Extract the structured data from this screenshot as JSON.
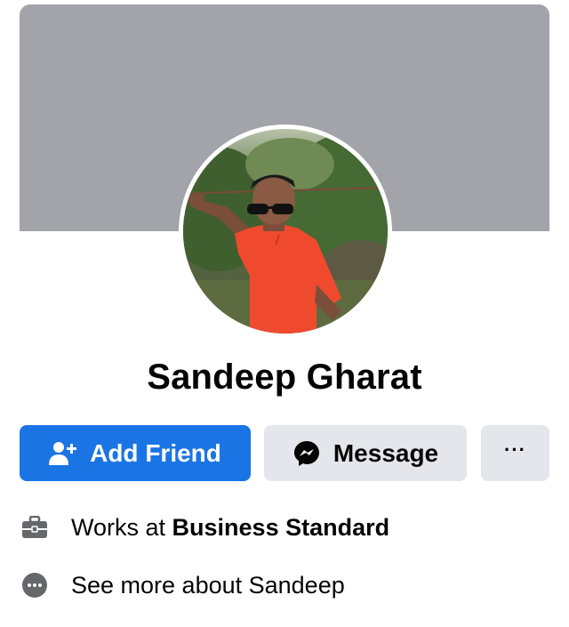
{
  "profile": {
    "name": "Sandeep Gharat",
    "photo": "profile-photo"
  },
  "actions": {
    "add_friend_label": "Add Friend",
    "message_label": "Message",
    "more_label": "···"
  },
  "intro": {
    "work_prefix": "Works at ",
    "work_company": "Business Standard",
    "see_more": "See more about Sandeep"
  },
  "colors": {
    "cover": "#a2a4a9",
    "primary": "#1b74e4",
    "secondary_button": "#e4e6eb",
    "text": "#050505",
    "icon": "#65676b"
  },
  "icons": {
    "add_friend": "add-friend-icon",
    "message": "messenger-icon",
    "work": "briefcase-icon",
    "more_info": "more-info-icon"
  }
}
